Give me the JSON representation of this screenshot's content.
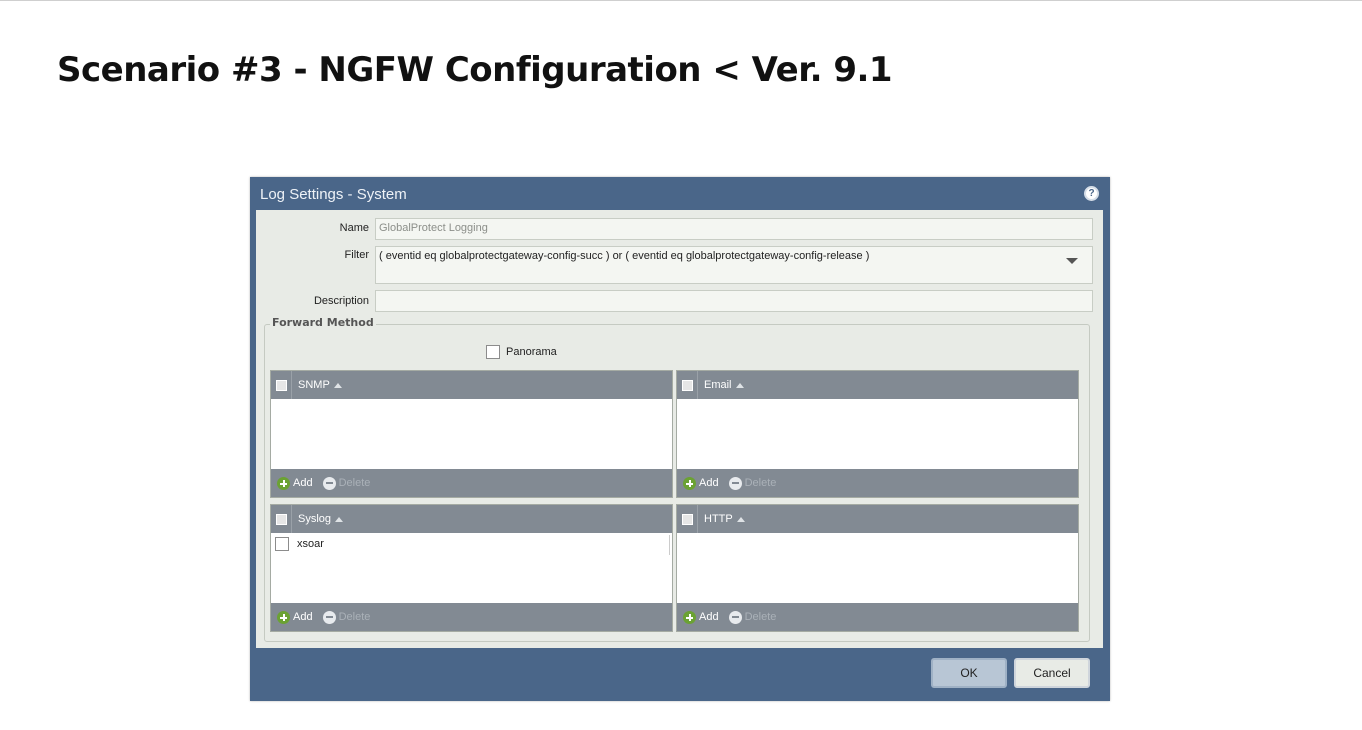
{
  "slide": {
    "title": "Scenario #3 - NGFW Configuration < Ver. 9.1"
  },
  "dialog": {
    "title": "Log Settings - System",
    "help_icon": "help-circle-icon",
    "help_glyph": "?",
    "fields": {
      "name_label": "Name",
      "name_value": "GlobalProtect Logging",
      "filter_label": "Filter",
      "filter_value": "( eventid eq globalprotectgateway-config-succ ) or  ( eventid eq globalprotectgateway-config-release )",
      "description_label": "Description",
      "description_value": ""
    },
    "forward_method": {
      "legend": "Forward Method",
      "panorama_label": "Panorama",
      "panorama_checked": false,
      "grids": {
        "snmp": {
          "header": "SNMP",
          "add": "Add",
          "delete": "Delete",
          "rows": []
        },
        "email": {
          "header": "Email",
          "add": "Add",
          "delete": "Delete",
          "rows": []
        },
        "syslog": {
          "header": "Syslog",
          "add": "Add",
          "delete": "Delete",
          "rows": [
            "xsoar"
          ]
        },
        "http": {
          "header": "HTTP",
          "add": "Add",
          "delete": "Delete",
          "rows": []
        }
      }
    },
    "buttons": {
      "ok": "OK",
      "cancel": "Cancel"
    },
    "colors": {
      "titlebar": "#4a6689",
      "body": "#e8ebe6",
      "grid_header": "#828a93",
      "add_icon": "#6ba233"
    }
  }
}
